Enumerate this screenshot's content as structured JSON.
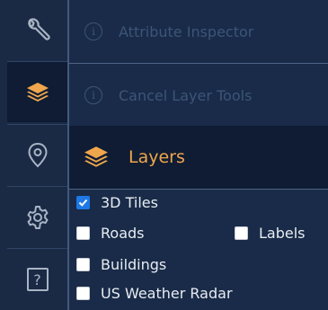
{
  "sidebar": {
    "items": [
      {
        "name": "tools",
        "icon": "wrench-icon",
        "active": false
      },
      {
        "name": "layers",
        "icon": "layers-icon",
        "active": true
      },
      {
        "name": "location",
        "icon": "map-pin-icon",
        "active": false
      },
      {
        "name": "settings",
        "icon": "gear-icon",
        "active": false
      },
      {
        "name": "help",
        "icon": "help-icon",
        "label": "?",
        "active": false
      }
    ]
  },
  "tools": {
    "attribute_inspector": "Attribute Inspector",
    "cancel_layer_tools": "Cancel Layer Tools",
    "info_glyph": "i"
  },
  "layers_panel": {
    "title": "Layers",
    "items": [
      {
        "label": "3D Tiles",
        "checked": true
      },
      {
        "label": "Roads",
        "checked": false
      },
      {
        "label": "Labels",
        "checked": false
      },
      {
        "label": "Buildings",
        "checked": false
      },
      {
        "label": "US Weather Radar",
        "checked": false
      }
    ]
  },
  "colors": {
    "accent": "#f0a64c",
    "background": "#172640",
    "checkbox_checked": "#1e78e6"
  }
}
